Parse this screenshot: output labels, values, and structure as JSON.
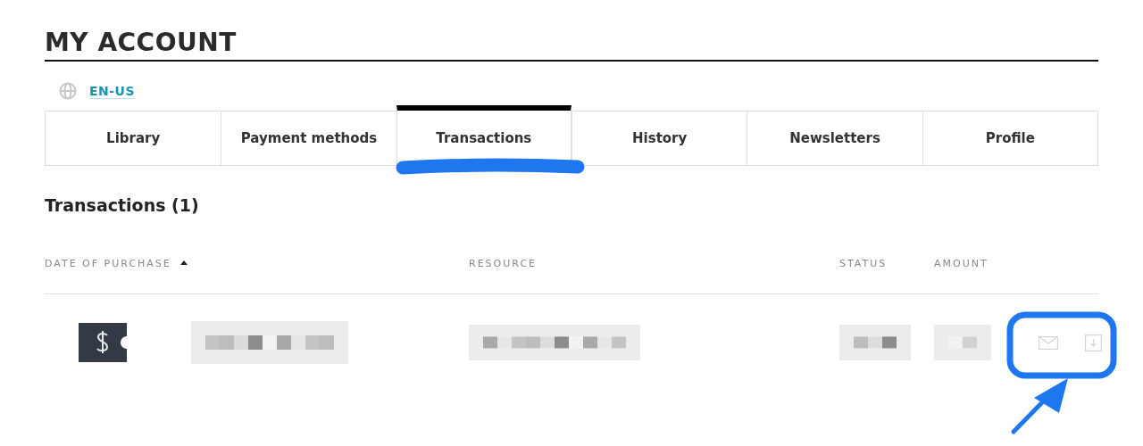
{
  "title": "MY ACCOUNT",
  "language": "EN-US",
  "tabs": [
    {
      "label": "Library",
      "selected": false
    },
    {
      "label": "Payment methods",
      "selected": false
    },
    {
      "label": "Transactions",
      "selected": true
    },
    {
      "label": "History",
      "selected": false
    },
    {
      "label": "Newsletters",
      "selected": false
    },
    {
      "label": "Profile",
      "selected": false
    }
  ],
  "section_title": "Transactions (1)",
  "table": {
    "columns": [
      {
        "label": "DATE OF PURCHASE",
        "sorted": true
      },
      {
        "label": "RESOURCE",
        "sorted": false
      },
      {
        "label": "STATUS",
        "sorted": false
      },
      {
        "label": "AMOUNT",
        "sorted": false
      }
    ],
    "rows": [
      {
        "blurred": true
      }
    ]
  }
}
